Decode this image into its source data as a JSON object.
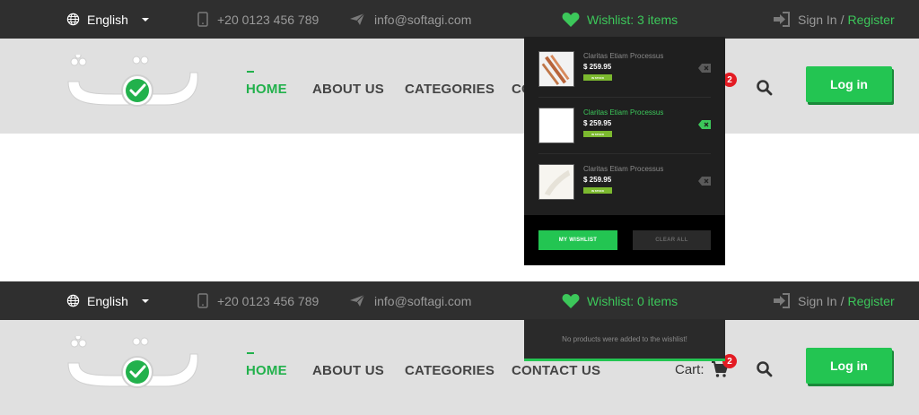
{
  "colors": {
    "accent": "#23c552",
    "topbar": "#2f2f2f",
    "navbar": "#e0e0e0",
    "badge": "#e31b23",
    "in_stock": "#7cb92f"
  },
  "top": {
    "language": "English",
    "phone": "+20 0123 456 789",
    "email": "info@softagi.com",
    "wishlist_label": "Wishlist: 3 items",
    "sign_in": "Sign In",
    "separator": "/",
    "register": "Register"
  },
  "nav": {
    "home": "HOME",
    "about": "ABOUT US",
    "categories": "CATEGORIES",
    "contact_partial": "CO",
    "cart_badge": "2",
    "login": "Log in"
  },
  "wishlist_dropdown": {
    "items": [
      {
        "name": "Claritas Etiam Processus",
        "price": "$ 259.95",
        "stock": "IN STOCK",
        "highlighted": false,
        "thumb": "copper-pipes"
      },
      {
        "name": "Claritas Etiam Processus",
        "price": "$ 259.95",
        "stock": "IN STOCK",
        "highlighted": true,
        "thumb": "white-product"
      },
      {
        "name": "Claritas Etiam Processus",
        "price": "$ 259.95",
        "stock": "IN STOCK",
        "highlighted": false,
        "thumb": "white-fabric"
      }
    ],
    "my_wishlist": "MY WISHLIST",
    "clear_all": "CLEAR ALL"
  },
  "top2": {
    "language": "English",
    "phone": "+20 0123 456 789",
    "email": "info@softagi.com",
    "wishlist_label": "Wishlist: 0 items",
    "sign_in": "Sign In",
    "separator": "/",
    "register": "Register"
  },
  "nav2": {
    "home": "HOME",
    "about": "ABOUT US",
    "categories": "CATEGORIES",
    "contact": "CONTACT US",
    "cart_label": "Cart:",
    "cart_badge": "2",
    "login": "Log in"
  },
  "wishlist_dropdown2": {
    "empty_message": "No products were added to the wishlist!"
  }
}
